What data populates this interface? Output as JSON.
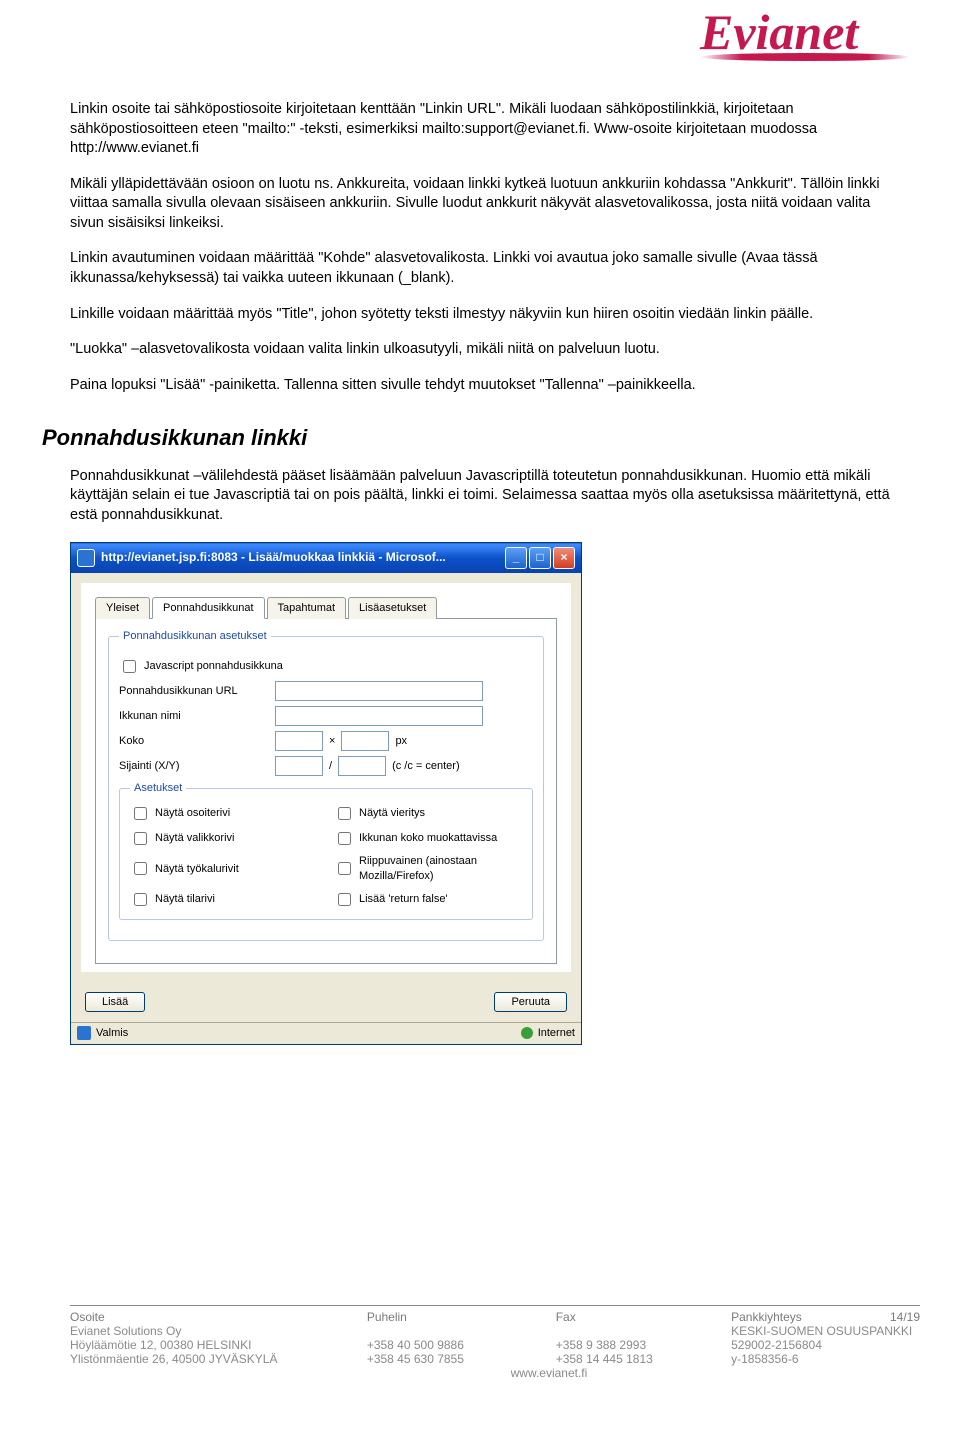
{
  "logo": {
    "text": "Evianet"
  },
  "paragraphs": {
    "p1": "Linkin osoite tai sähköpostiosoite kirjoitetaan kenttään \"Linkin URL\". Mikäli luodaan sähköpostilinkkiä, kirjoitetaan sähköpostiosoitteen eteen \"mailto:\" -teksti, esimerkiksi mailto:support@evianet.fi. Www-osoite kirjoitetaan muodossa http://www.evianet.fi",
    "p2": "Mikäli ylläpidettävään osioon on luotu ns. Ankkureita, voidaan linkki kytkeä luotuun ankkuriin kohdassa \"Ankkurit\". Tällöin linkki viittaa samalla sivulla olevaan sisäiseen ankkuriin. Sivulle luodut ankkurit näkyvät alasvetovalikossa, josta niitä voidaan valita sivun sisäisiksi linkeiksi.",
    "p3": "Linkin avautuminen voidaan määrittää \"Kohde\" alasvetovalikosta. Linkki voi avautua joko samalle sivulle (Avaa tässä ikkunassa/kehyksessä) tai vaikka uuteen ikkunaan (_blank).",
    "p4": "Linkille voidaan määrittää myös \"Title\", johon syötetty teksti ilmestyy näkyviin kun hiiren osoitin viedään linkin päälle.",
    "p5": "\"Luokka\" –alasvetovalikosta voidaan valita linkin ulkoasutyyli, mikäli niitä on palveluun luotu.",
    "p6": "Paina lopuksi \"Lisää\" -painiketta. Tallenna sitten sivulle tehdyt muutokset \"Tallenna\" –painikkeella."
  },
  "section_heading": "Ponnahdusikkunan linkki",
  "section_p": "Ponnahdusikkunat –välilehdestä pääset lisäämään palveluun Javascriptillä toteutetun ponnahdusikkunan. Huomio että mikäli käyttäjän selain ei tue Javascriptiä tai on pois päältä, linkki ei toimi. Selaimessa saattaa myös olla asetuksissa määritettynä, että estä ponnahdusikkunat.",
  "dialog": {
    "title": "http://evianet.jsp.fi:8083 - Lisää/muokkaa linkkiä - Microsof...",
    "tabs": [
      "Yleiset",
      "Ponnahdusikkunat",
      "Tapahtumat",
      "Lisäasetukset"
    ],
    "fieldset1_legend": "Ponnahdusikkunan asetukset",
    "js_popup_label": "Javascript ponnahdusikkuna",
    "url_label": "Ponnahdusikkunan URL",
    "name_label": "Ikkunan nimi",
    "size_label": "Koko",
    "size_sep": "×",
    "size_unit": "px",
    "pos_label": "Sijainti (X/Y)",
    "pos_sep": "/",
    "pos_note": "(c /c = center)",
    "fieldset2_legend": "Asetukset",
    "opts": [
      "Näytä osoiterivi",
      "Näytä vieritys",
      "Näytä valikkorivi",
      "Ikkunan koko muokattavissa",
      "Näytä työkalurivit",
      "Riippuvainen (ainostaan Mozilla/Firefox)",
      "Näytä tilarivi",
      "Lisää 'return false'"
    ],
    "btn_insert": "Lisää",
    "btn_cancel": "Peruuta",
    "status_ready": "Valmis",
    "status_zone": "Internet"
  },
  "footer": {
    "h1": "Osoite",
    "h2": "Puhelin",
    "h3": "Fax",
    "h4": "Pankkiyhteys",
    "page": "14/19",
    "r1c1": "Evianet Solutions Oy",
    "r1c4": "KESKI-SUOMEN OSUUSPANKKI",
    "r2c1": "Höyläämötie 12, 00380 HELSINKI",
    "r2c2": "+358 40 500 9886",
    "r2c3": "+358 9 388 2993",
    "r2c4": "529002-2156804",
    "r3c1": "Ylistönmäentie 26, 40500 JYVÄSKYLÄ",
    "r3c2": "+358 45 630 7855",
    "r3c3": "+358 14 445 1813",
    "r3c4": "y-1858356-6",
    "www": "www.evianet.fi"
  }
}
